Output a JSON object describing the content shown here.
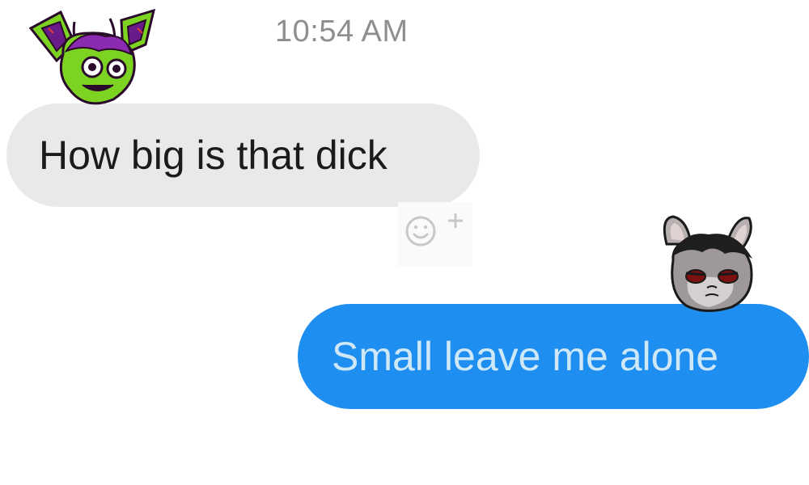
{
  "conversation": {
    "timestamp": "10:54 AM",
    "messages": [
      {
        "direction": "incoming",
        "text": "How big is that dick"
      },
      {
        "direction": "outgoing",
        "text": "Small leave me alone"
      }
    ]
  },
  "icons": {
    "reaction": "smiley-add-reaction-icon",
    "avatar_left": "green-purple-creature-sticker",
    "avatar_right": "grey-bunny-sticker"
  },
  "colors": {
    "incoming_bubble": "#e9e9eb",
    "outgoing_bubble": "#1e8ef0",
    "outgoing_text": "#cfe8f8",
    "timestamp_text": "#8e8e8e"
  }
}
